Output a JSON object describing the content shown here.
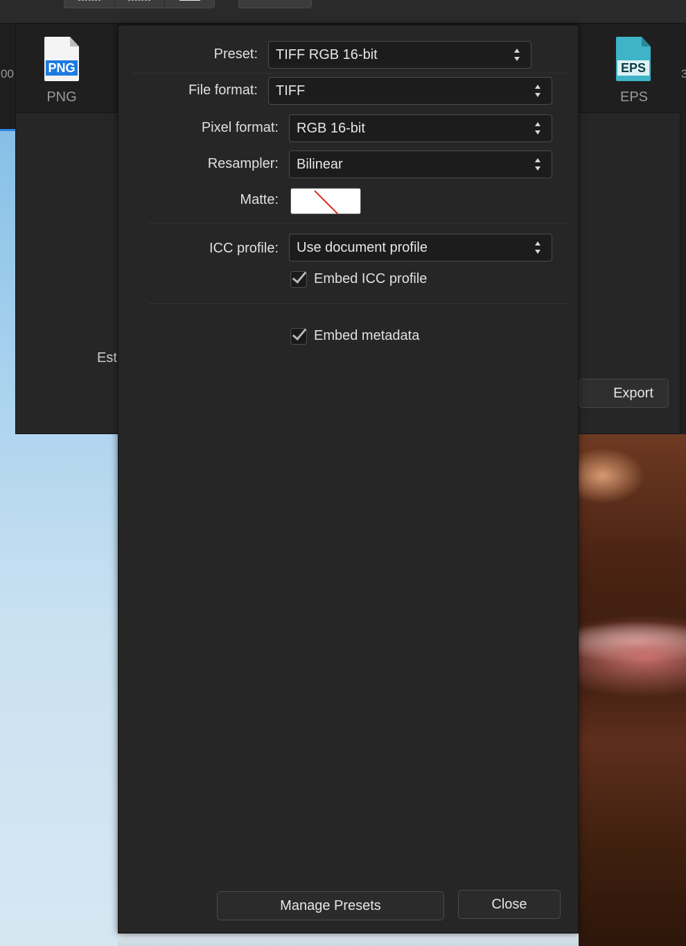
{
  "background": {
    "formats": [
      {
        "label": "PNG",
        "badge": "PNG",
        "color": "#1d7be0"
      },
      {
        "label": "EPS",
        "badge": "EPS",
        "color": "#2aa3b8"
      }
    ],
    "left_edge_text": "00",
    "right_edge_text": "3",
    "partial_label": "Est",
    "export_label": "Export"
  },
  "panel": {
    "preset": {
      "label": "Preset:",
      "value": "TIFF RGB 16-bit"
    },
    "file_format": {
      "label": "File format:",
      "value": "TIFF"
    },
    "pixel_format": {
      "label": "Pixel format:",
      "value": "RGB 16-bit"
    },
    "resampler": {
      "label": "Resampler:",
      "value": "Bilinear"
    },
    "matte": {
      "label": "Matte:"
    },
    "icc_profile": {
      "label": "ICC profile:",
      "value": "Use document profile"
    },
    "embed_icc": {
      "label": "Embed ICC profile",
      "checked": true
    },
    "embed_metadata": {
      "label": "Embed metadata",
      "checked": true
    },
    "manage_presets_label": "Manage Presets",
    "close_label": "Close"
  }
}
